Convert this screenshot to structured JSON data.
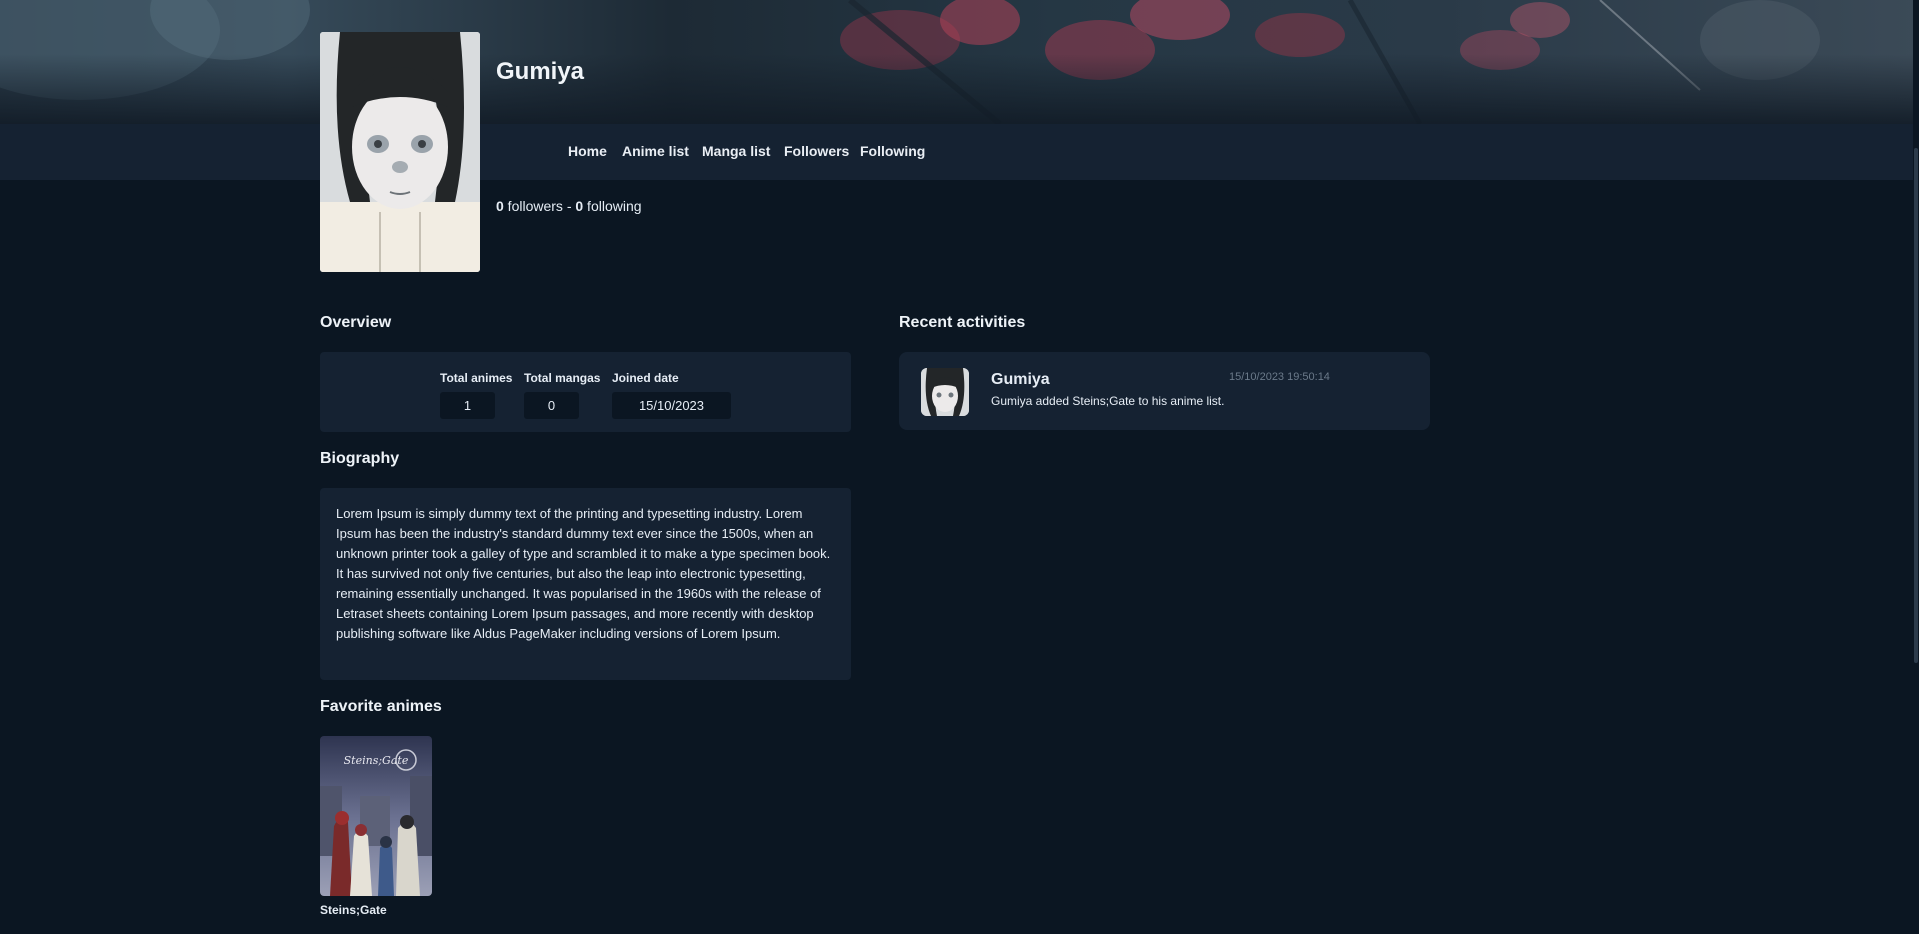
{
  "profile": {
    "username": "Gumiya",
    "followers_count": "0",
    "followers_label": " followers - ",
    "following_count": "0",
    "following_label": " following"
  },
  "nav": {
    "items": [
      "Home",
      "Anime list",
      "Manga list",
      "Followers",
      "Following"
    ]
  },
  "overview": {
    "title": "Overview",
    "stats": [
      {
        "label": "Total animes",
        "value": "1"
      },
      {
        "label": "Total mangas",
        "value": "0"
      },
      {
        "label": "Joined date",
        "value": "15/10/2023"
      }
    ]
  },
  "biography": {
    "title": "Biography",
    "text": "Lorem Ipsum is simply dummy text of the printing and typesetting industry. Lorem Ipsum has been the industry's standard dummy text ever since the 1500s, when an unknown printer took a galley of type and scrambled it to make a type specimen book. It has survived not only five centuries, but also the leap into electronic typesetting, remaining essentially unchanged. It was popularised in the 1960s with the release of Letraset sheets containing Lorem Ipsum passages, and more recently with desktop publishing software like Aldus PageMaker including versions of Lorem Ipsum."
  },
  "favorites": {
    "title": "Favorite animes",
    "items": [
      {
        "title": "Steins;Gate",
        "cover_text": "Steins;Gate"
      }
    ]
  },
  "activities": {
    "title": "Recent activities",
    "items": [
      {
        "user": "Gumiya",
        "timestamp": "15/10/2023 19:50:14",
        "text": "Gumiya added Steins;Gate to his anime list."
      }
    ]
  },
  "colors": {
    "background": "#0b1622",
    "card": "#152232",
    "text": "#e6edf5",
    "muted": "#6b7a8a"
  }
}
